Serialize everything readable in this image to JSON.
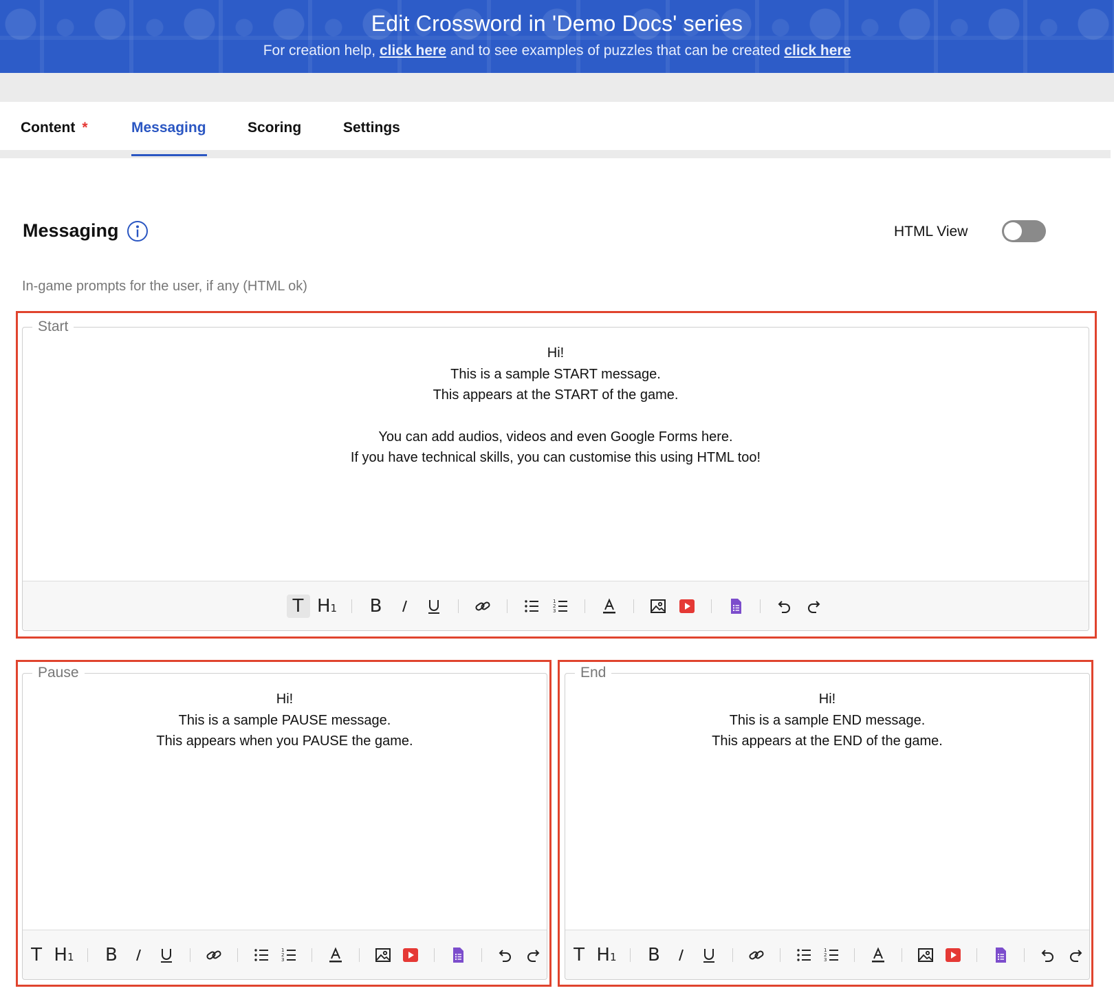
{
  "banner": {
    "title": "Edit Crossword in 'Demo Docs' series",
    "help_prefix": "For creation help,",
    "help_link": "click here",
    "help_middle": "and to see examples of puzzles that can be created",
    "examples_link": "click here"
  },
  "tabs": [
    {
      "label": "Content",
      "required_mark": "*"
    },
    {
      "label": "Messaging"
    },
    {
      "label": "Scoring"
    },
    {
      "label": "Settings"
    }
  ],
  "active_tab": "Messaging",
  "section": {
    "title": "Messaging",
    "html_view_label": "HTML View",
    "html_view_enabled": false,
    "hint": "In-game prompts for the user, if any (HTML ok)"
  },
  "editors": {
    "start": {
      "legend": "Start",
      "lines": [
        "Hi!",
        "This is a sample START message.",
        "This appears at the START of the game.",
        "",
        "You can add audios, videos and even Google Forms here.",
        "If you have technical skills, you can customise this using HTML too!"
      ]
    },
    "pause": {
      "legend": "Pause",
      "lines": [
        "Hi!",
        "This is a sample PAUSE message.",
        "This appears when you PAUSE the game."
      ]
    },
    "end": {
      "legend": "End",
      "lines": [
        "Hi!",
        "This is a sample END message.",
        "This appears at the END of the game."
      ]
    }
  },
  "toolbar_icons": [
    "text-style-icon",
    "heading-icon",
    "bold-icon",
    "italic-icon",
    "underline-icon",
    "link-icon",
    "bullet-list-icon",
    "numbered-list-icon",
    "text-color-icon",
    "image-icon",
    "video-icon",
    "google-forms-icon",
    "undo-icon",
    "redo-icon"
  ],
  "colors": {
    "banner": "#2d5cc8",
    "accent": "#2a56c2",
    "highlight_frame": "#e0442e",
    "video_icon": "#e53935",
    "forms_icon": "#7c4dcc"
  }
}
